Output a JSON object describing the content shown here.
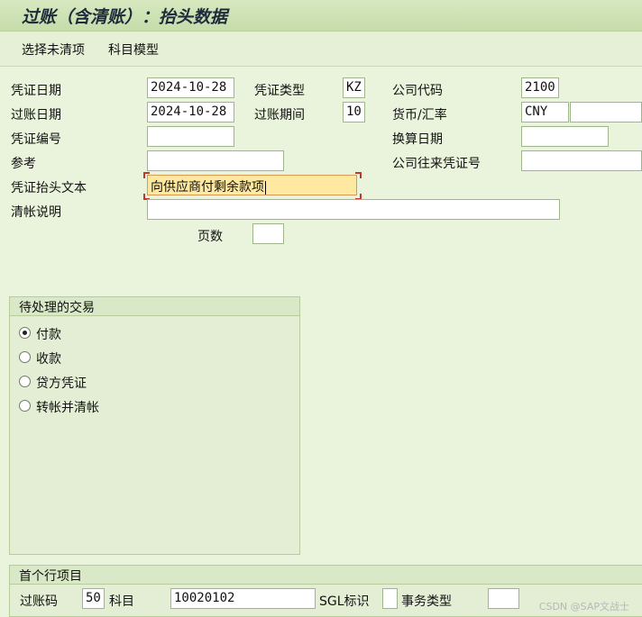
{
  "title": "过账（含清账）：抬头数据",
  "toolbar": {
    "select_open_items": "选择未清项",
    "account_model": "科目模型"
  },
  "header": {
    "doc_date_label": "凭证日期",
    "doc_date": "2024-10-28",
    "doc_type_label": "凭证类型",
    "doc_type": "KZ",
    "company_code_label": "公司代码",
    "company_code": "2100",
    "posting_date_label": "过账日期",
    "posting_date": "2024-10-28",
    "period_label": "过账期间",
    "period": "10",
    "currency_label": "货币/汇率",
    "currency": "CNY",
    "exchange_rate": "",
    "doc_number_label": "凭证编号",
    "doc_number": "",
    "translation_date_label": "换算日期",
    "translation_date": "",
    "reference_label": "参考",
    "reference": "",
    "cross_cc_label": "公司往来凭证号",
    "cross_cc": "",
    "header_text_label": "凭证抬头文本",
    "header_text": "向供应商付剩余款项",
    "clearing_text_label": "清帐说明",
    "clearing_text": "",
    "pages_label": "页数",
    "pages": ""
  },
  "transaction_group": {
    "title": "待处理的交易",
    "options": [
      "付款",
      "收款",
      "贷方凭证",
      "转帐并清帐"
    ],
    "selected_index": 0
  },
  "first_line": {
    "title": "首个行项目",
    "posting_key_label": "过账码",
    "posting_key": "50",
    "account_label": "科目",
    "account": "10020102",
    "sgl_label": "SGL标识",
    "sgl": "",
    "transaction_type_label": "事务类型",
    "transaction_type": ""
  },
  "watermark": "CSDN @SAP文战士",
  "colors": {
    "active_field": "#ffe9a0",
    "background": "#eaf3dc",
    "title_bar": "#c6dcaa"
  }
}
